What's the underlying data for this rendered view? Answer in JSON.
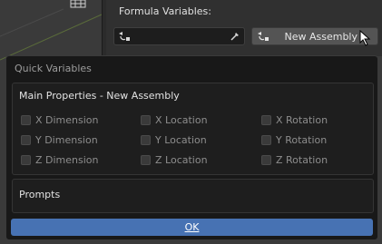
{
  "header": {
    "formula_label": "Formula Variables:",
    "var_field_value": "",
    "new_assembly_label": "New Assembly"
  },
  "popup": {
    "title": "Quick Variables",
    "main": {
      "title": "Main Properties - New Assembly",
      "checkboxes": [
        [
          "X Dimension",
          "X Location",
          "X Rotation"
        ],
        [
          "Y Dimension",
          "Y Location",
          "Y Rotation"
        ],
        [
          "Z Dimension",
          "Z Location",
          "Z Rotation"
        ]
      ]
    },
    "prompts_title": "Prompts",
    "ok_label": "OK"
  },
  "colors": {
    "accent": "#4772b3",
    "panel": "#303030",
    "popup_bg": "#181818"
  }
}
